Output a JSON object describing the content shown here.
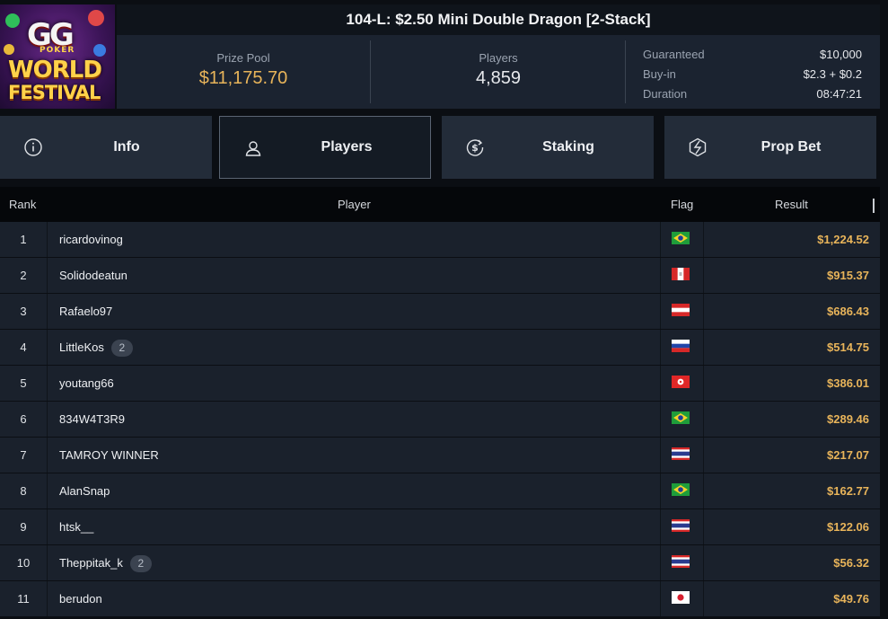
{
  "logo": {
    "gg": "GG",
    "poker": "POKER",
    "line1": "WORLD",
    "line2": "FESTIVAL"
  },
  "title": "104-L: $2.50 Mini Double Dragon [2-Stack]",
  "stats": {
    "prize_pool_label": "Prize Pool",
    "prize_pool_value": "$11,175.70",
    "players_label": "Players",
    "players_value": "4,859"
  },
  "details": [
    {
      "label": "Guaranteed",
      "value": "$10,000"
    },
    {
      "label": "Buy-in",
      "value": "$2.3 + $0.2"
    },
    {
      "label": "Duration",
      "value": "08:47:21"
    }
  ],
  "tabs": [
    {
      "label": "Info",
      "icon": "info-icon"
    },
    {
      "label": "Players",
      "icon": "user-icon"
    },
    {
      "label": "Staking",
      "icon": "dollar-coin-icon"
    },
    {
      "label": "Prop Bet",
      "icon": "prop-bet-icon"
    }
  ],
  "active_tab": "Players",
  "table": {
    "headers": {
      "rank": "Rank",
      "player": "Player",
      "flag": "Flag",
      "result": "Result"
    },
    "rows": [
      {
        "rank": "1",
        "player": "ricardovinog",
        "badge": "",
        "flag": "brazil",
        "result": "$1,224.52"
      },
      {
        "rank": "2",
        "player": "Solidodeatun",
        "badge": "",
        "flag": "peru",
        "result": "$915.37"
      },
      {
        "rank": "3",
        "player": "Rafaelo97",
        "badge": "",
        "flag": "austria",
        "result": "$686.43"
      },
      {
        "rank": "4",
        "player": "LittleKos",
        "badge": "2",
        "flag": "russia",
        "result": "$514.75"
      },
      {
        "rank": "5",
        "player": "youtang66",
        "badge": "",
        "flag": "hong-kong",
        "result": "$386.01"
      },
      {
        "rank": "6",
        "player": "834W4T3R9",
        "badge": "",
        "flag": "brazil",
        "result": "$289.46"
      },
      {
        "rank": "7",
        "player": "TAMROY WINNER",
        "badge": "",
        "flag": "thailand",
        "result": "$217.07"
      },
      {
        "rank": "8",
        "player": "AlanSnap",
        "badge": "",
        "flag": "brazil",
        "result": "$162.77"
      },
      {
        "rank": "9",
        "player": "htsk__",
        "badge": "",
        "flag": "thailand",
        "result": "$122.06"
      },
      {
        "rank": "10",
        "player": "Theppitak_k",
        "badge": "2",
        "flag": "thailand",
        "result": "$56.32"
      },
      {
        "rank": "11",
        "player": "berudon",
        "badge": "",
        "flag": "japan",
        "result": "$49.76"
      }
    ]
  },
  "colors": {
    "accent_gold": "#e8b45a",
    "row_bg": "#1a212c",
    "tab_bg": "#232c39"
  }
}
